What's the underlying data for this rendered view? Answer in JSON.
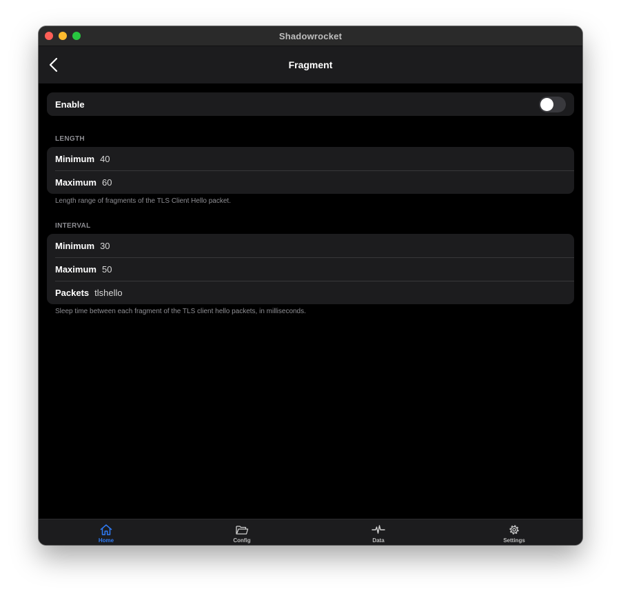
{
  "window": {
    "title": "Shadowrocket"
  },
  "navbar": {
    "title": "Fragment"
  },
  "enable": {
    "label": "Enable",
    "value": false
  },
  "length": {
    "header": "LENGTH",
    "rows": [
      {
        "label": "Minimum",
        "value": "40"
      },
      {
        "label": "Maximum",
        "value": "60"
      }
    ],
    "footer": "Length range of fragments of the TLS Client Hello packet."
  },
  "interval": {
    "header": "INTERVAL",
    "rows": [
      {
        "label": "Minimum",
        "value": "30"
      },
      {
        "label": "Maximum",
        "value": "50"
      },
      {
        "label": "Packets",
        "value": "tlshello"
      }
    ],
    "footer": "Sleep time between each fragment of the TLS client hello packets, in milliseconds."
  },
  "tabs": [
    {
      "label": "Home",
      "icon": "house-icon",
      "active": true
    },
    {
      "label": "Config",
      "icon": "folder-icon",
      "active": false
    },
    {
      "label": "Data",
      "icon": "waveform-icon",
      "active": false
    },
    {
      "label": "Settings",
      "icon": "gear-icon",
      "active": false
    }
  ],
  "colors": {
    "accent": "#2f7bf5",
    "background": "#000000",
    "cell": "#1c1c1e"
  }
}
